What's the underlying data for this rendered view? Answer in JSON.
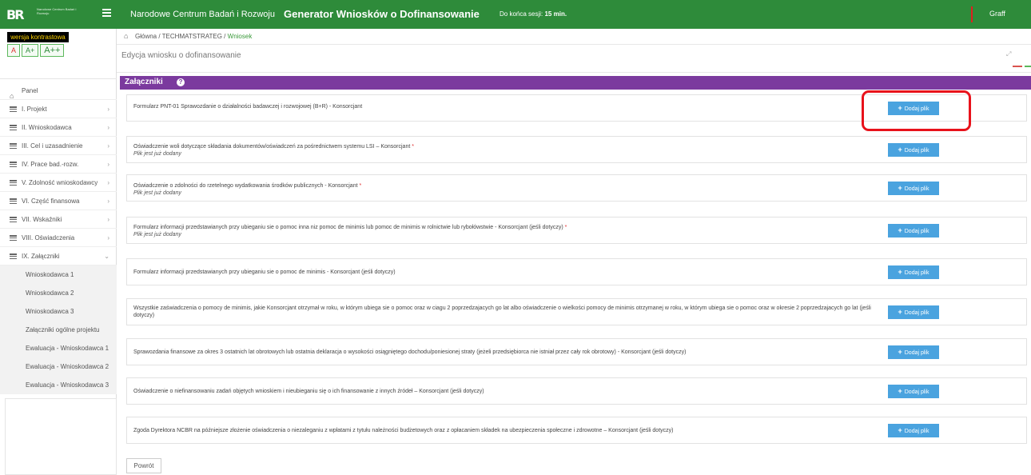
{
  "topbar": {
    "logo_mark": "BR",
    "logo_subtitle": "Narodowe Centrum Badań i Rozwoju",
    "org_name": "Narodowe Centrum Badań i Rozwoju",
    "app_title": "Generator Wniosków o Dofinansowanie",
    "session_prefix": "Do końca sesji:",
    "session_time": "15 min.",
    "user": "Graff",
    "accent_color": "#2e8b3a"
  },
  "accessibility": {
    "contrast_label": "wersja kontrastowa",
    "font_small": "A",
    "font_medium": "A+",
    "font_large": "A++"
  },
  "sidebar": {
    "home_label": "Panel",
    "items": [
      {
        "label": "I. Projekt"
      },
      {
        "label": "II. Wnioskodawca"
      },
      {
        "label": "III. Cel i uzasadnienie"
      },
      {
        "label": "IV. Prace bad.-rozw."
      },
      {
        "label": "V. Zdolność wnioskodawcy"
      },
      {
        "label": "VI. Część finansowa"
      },
      {
        "label": "VII. Wskaźniki"
      },
      {
        "label": "VIII. Oświadczenia"
      },
      {
        "label": "IX. Załączniki"
      }
    ],
    "sub_items": [
      {
        "label": "Wnioskodawca 1"
      },
      {
        "label": "Wnioskodawca 2"
      },
      {
        "label": "Wnioskodawca 3"
      },
      {
        "label": "Załączniki ogólne projektu"
      },
      {
        "label": "Ewaluacja - Wnioskodawca 1"
      },
      {
        "label": "Ewaluacja - Wnioskodawca 2"
      },
      {
        "label": "Ewaluacja - Wnioskodawca 3"
      }
    ]
  },
  "breadcrumb": {
    "items": [
      "Główna",
      "TECHMATSTRATEG",
      "Wniosek"
    ],
    "separator": "/"
  },
  "page": {
    "title": "Edycja wniosku o dofinansowanie"
  },
  "panel": {
    "title": "Załączniki",
    "header_color": "#7b3a9e",
    "add_button_label": "Dodaj plik",
    "back_label": "Powrót",
    "attachments": [
      {
        "label": "Formularz PNT-01 Sprawozdanie o działalności badawczej i rozwojowej (B+R) - Konsorcjant",
        "required": "",
        "note": ""
      },
      {
        "label": "Oświadczenie woli dotyczące składania dokumentów/oświadczeń za pośrednictwem systemu LSI – Konsorcjant",
        "required": "*",
        "note": "Plik jest już dodany"
      },
      {
        "label": "Oświadczenie o zdolności do rzetelnego wydatkowania środków publicznych - Konsorcjant",
        "required": "*",
        "note": "Plik jest już dodany"
      },
      {
        "label": "Formularz informacji przedstawianych przy ubieganiu sie o pomoc inna niz pomoc de minimis lub pomoc de minimis w rolnictwie lub rybołówstwie - Konsorcjant (jeśli dotyczy)",
        "required": "*",
        "note": "Plik jest już dodany"
      },
      {
        "label": "Formularz informacji przedstawianych przy ubieganiu sie o pomoc de minimis - Konsorcjant (jeśli dotyczy)",
        "required": "",
        "note": ""
      },
      {
        "label": "Wszystkie zaświadczenia o pomocy de minimis, jakie Konsorcjant otrzymał w roku, w którym ubiega sie o pomoc oraz w ciagu 2 poprzedzajacych go lat albo oświadczenie o wielkości pomocy de minimis otrzymanej w roku, w którym ubiega sie o pomoc oraz w okresie 2 poprzedzajacych go lat (jeśli dotyczy)",
        "required": "",
        "note": ""
      },
      {
        "label": "Sprawozdania finansowe za okres 3 ostatnich lat obrotowych lub ostatnia deklaracja o wysokości osiągniętego dochodu/poniesionej straty (jeżeli przedsiębiorca nie istniał przez cały rok obrotowy) - Konsorcjant (jeśli dotyczy)",
        "required": "",
        "note": ""
      },
      {
        "label": "Oświadczenie o niefinansowaniu zadań objętych wnioskiem i nieubieganiu się o ich finansowanie z innych źródeł – Konsorcjant (jeśli dotyczy)",
        "required": "",
        "note": ""
      },
      {
        "label": "Zgoda Dyrektora NCBR na późniejsze złożenie oświadczenia o niezaleganiu z wpłatami z tytułu należności budżetowych oraz z opłacaniem składek na ubezpieczenia społeczne i zdrowotne – Konsorcjant (jeśli dotyczy)",
        "required": "",
        "note": ""
      }
    ]
  }
}
